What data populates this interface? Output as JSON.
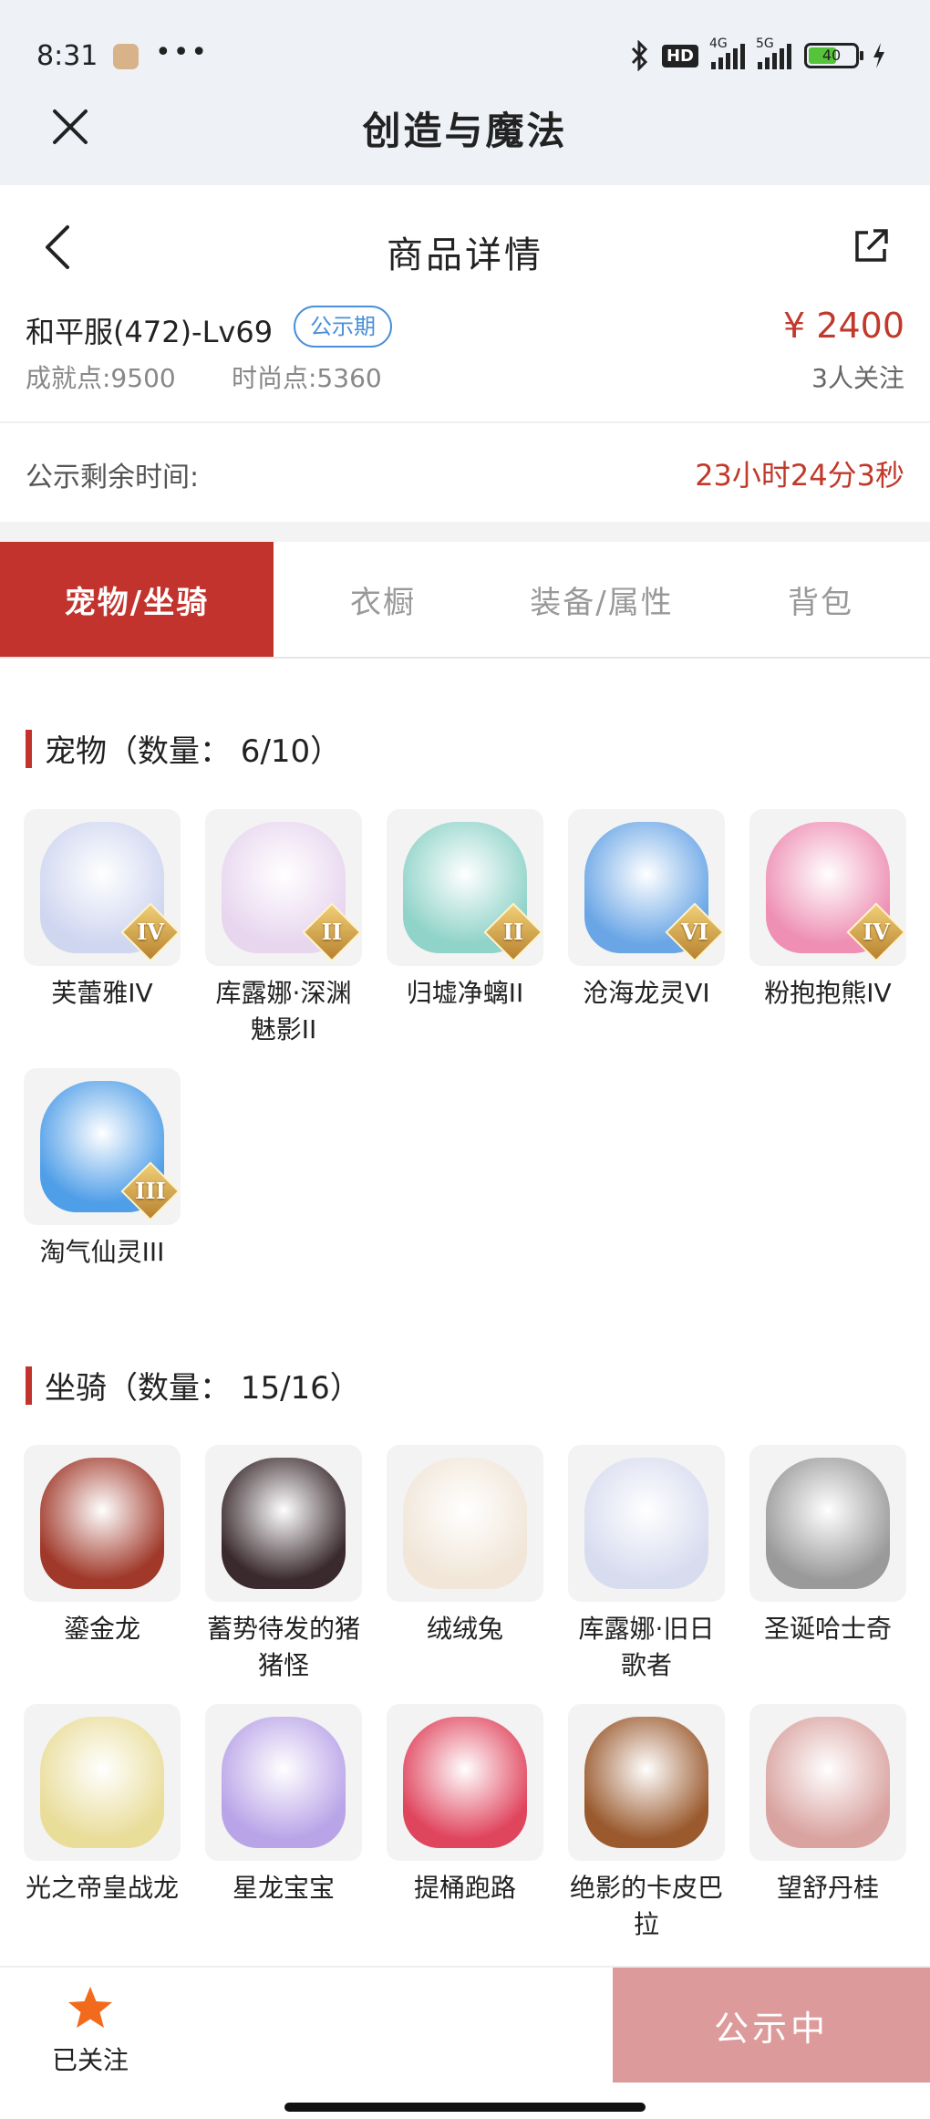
{
  "status_bar": {
    "time": "8:31",
    "more": "•••",
    "hd": "HD",
    "net1": "4G",
    "net2": "5G",
    "battery": "40"
  },
  "app": {
    "title": "创造与魔法"
  },
  "nav": {
    "title": "商品详情"
  },
  "product": {
    "name": "和平服(472)-Lv69",
    "badge": "公示期",
    "price": "¥ 2400",
    "achievement": "成就点:9500",
    "fashion": "时尚点:5360",
    "followers": "3人关注"
  },
  "timer": {
    "label": "公示剩余时间:",
    "value": "23小时24分3秒"
  },
  "tabs": [
    {
      "label": "宠物/坐骑"
    },
    {
      "label": "衣橱"
    },
    {
      "label": "装备/属性"
    },
    {
      "label": "背包"
    }
  ],
  "pets": {
    "header": "宠物（数量： 6/10）",
    "items": [
      {
        "name": "芙蕾雅IV",
        "rank": "IV",
        "color": "#cfd6f0"
      },
      {
        "name": "库露娜·深渊魅影II",
        "rank": "II",
        "color": "#e8d6ef"
      },
      {
        "name": "归墟净螭II",
        "rank": "II",
        "color": "#8fd3c9"
      },
      {
        "name": "沧海龙灵VI",
        "rank": "VI",
        "color": "#6aa6e6"
      },
      {
        "name": "粉抱抱熊IV",
        "rank": "IV",
        "color": "#ee8fb3"
      },
      {
        "name": "淘气仙灵III",
        "rank": "III",
        "color": "#4f9ee8"
      }
    ]
  },
  "mounts": {
    "header": "坐骑（数量： 15/16）",
    "items": [
      {
        "name": "鎏金龙",
        "color": "#a0392a"
      },
      {
        "name": "蓄势待发的猪猪怪",
        "color": "#3a2a2e"
      },
      {
        "name": "绒绒兔",
        "color": "#f1e6d8"
      },
      {
        "name": "库露娜·旧日歌者",
        "color": "#d8dcef"
      },
      {
        "name": "圣诞哈士奇",
        "color": "#9a9a9a"
      },
      {
        "name": "光之帝皇战龙",
        "color": "#e9dd9a"
      },
      {
        "name": "星龙宝宝",
        "color": "#b9a4e8"
      },
      {
        "name": "提桶跑路",
        "color": "#e0455e"
      },
      {
        "name": "绝影的卡皮巴拉",
        "color": "#9a5a2e"
      },
      {
        "name": "望舒丹桂",
        "color": "#d9a3a0"
      }
    ]
  },
  "bottom": {
    "follow_label": "已关注",
    "status_button": "公示中"
  }
}
